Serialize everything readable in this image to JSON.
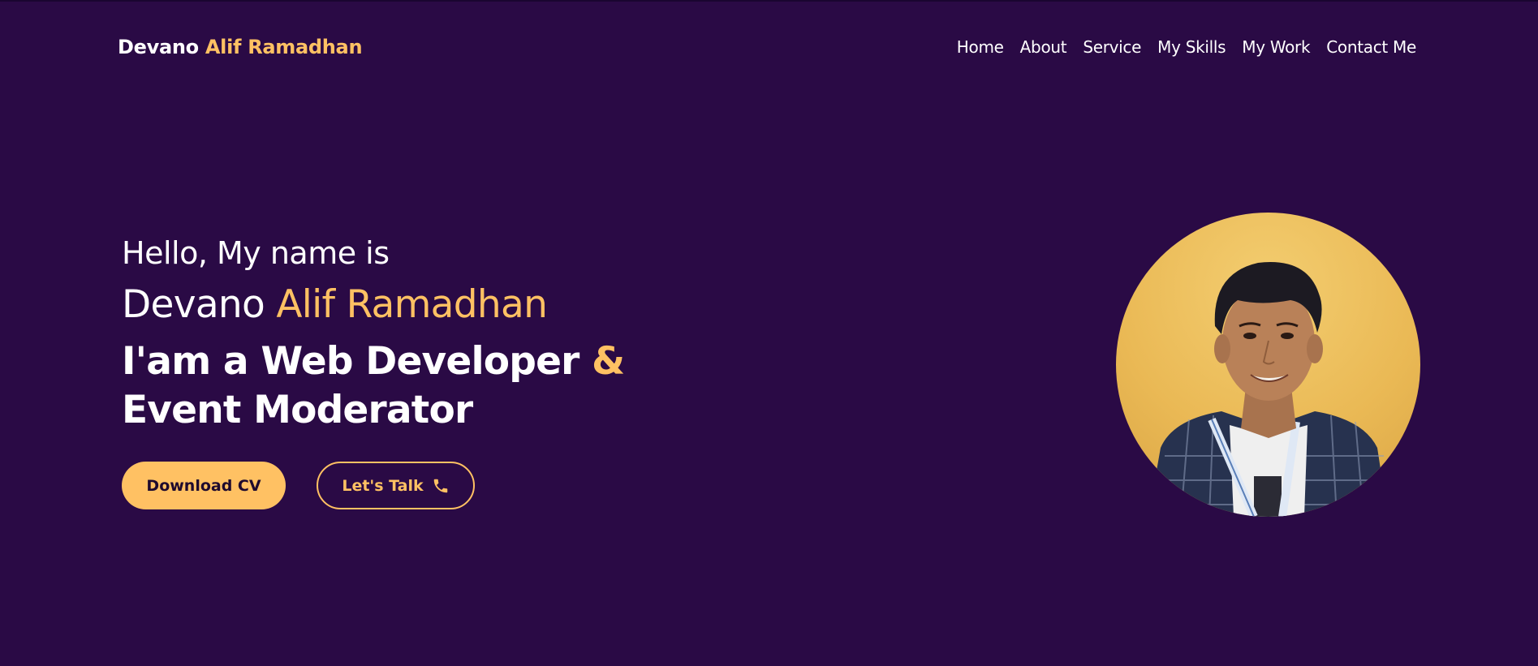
{
  "brand": {
    "first": "Devano ",
    "last": "Alif Ramadhan"
  },
  "nav": {
    "items": [
      {
        "label": "Home"
      },
      {
        "label": "About"
      },
      {
        "label": "Service"
      },
      {
        "label": "My Skills"
      },
      {
        "label": "My Work"
      },
      {
        "label": "Contact Me"
      }
    ]
  },
  "hero": {
    "greeting": "Hello, My name is",
    "name_first": "Devano ",
    "name_last": "Alif Ramadhan",
    "role_part1": "I'am a Web Developer ",
    "role_amp": "&",
    "role_part2": " Event Moderator"
  },
  "buttons": {
    "download": "Download CV",
    "talk": "Let's Talk",
    "talk_icon": "phone-icon"
  },
  "avatar": {
    "icon": "profile-photo"
  },
  "colors": {
    "background": "#2a0a45",
    "accent": "#ffc163",
    "text": "#ffffff"
  }
}
